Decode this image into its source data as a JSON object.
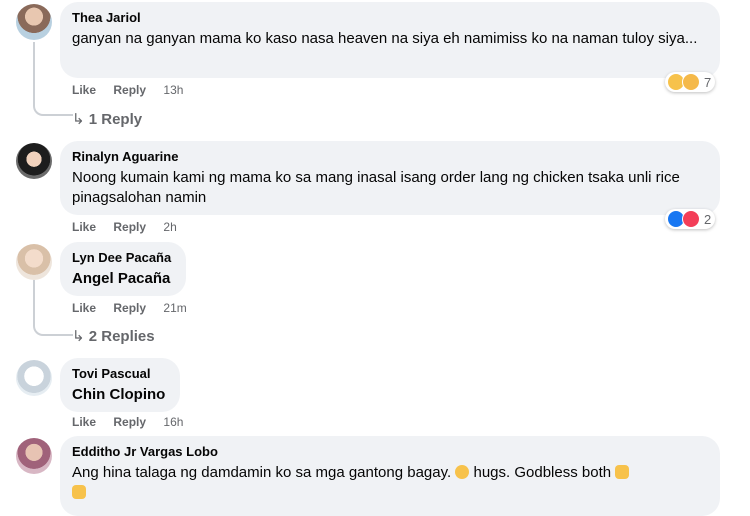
{
  "comments": [
    {
      "author": "Thea Jariol",
      "text": "ganyan na ganyan mama ko kaso nasa heaven na siya eh namimiss ko na naman tuloy siya...",
      "like": "Like",
      "reply": "Reply",
      "time": "13h",
      "reaction_count": "7",
      "replies": "1 Reply"
    },
    {
      "author": "Rinalyn Aguarine",
      "text": "Noong kumain kami ng mama ko sa mang inasal isang order lang ng chicken tsaka unli rice pinagsalohan namin",
      "like": "Like",
      "reply": "Reply",
      "time": "2h",
      "reaction_count": "2"
    },
    {
      "author": "Lyn Dee Pacaña",
      "text": "Angel Pacaña",
      "like": "Like",
      "reply": "Reply",
      "time": "21m",
      "replies": "2 Replies"
    },
    {
      "author": "Tovi Pascual",
      "text": "Chin Clopino",
      "like": "Like",
      "reply": "Reply",
      "time": "16h"
    },
    {
      "author": "Edditho Jr Vargas Lobo",
      "text_part1": "Ang hina talaga ng damdamin ko sa mga gantong bagay.",
      "text_part2": "hugs. Godbless both"
    }
  ],
  "colors": {
    "bubble": "#f0f2f5",
    "meta": "#65676b",
    "like_blue": "#1877f2",
    "heart_red": "#f33e58",
    "emoji_yellow": "#f7c24b"
  },
  "icons": [
    "reply-arrow-icon",
    "haha-reaction-icon",
    "sad-reaction-icon",
    "like-reaction-icon",
    "heart-reaction-icon",
    "emoji-icon"
  ]
}
